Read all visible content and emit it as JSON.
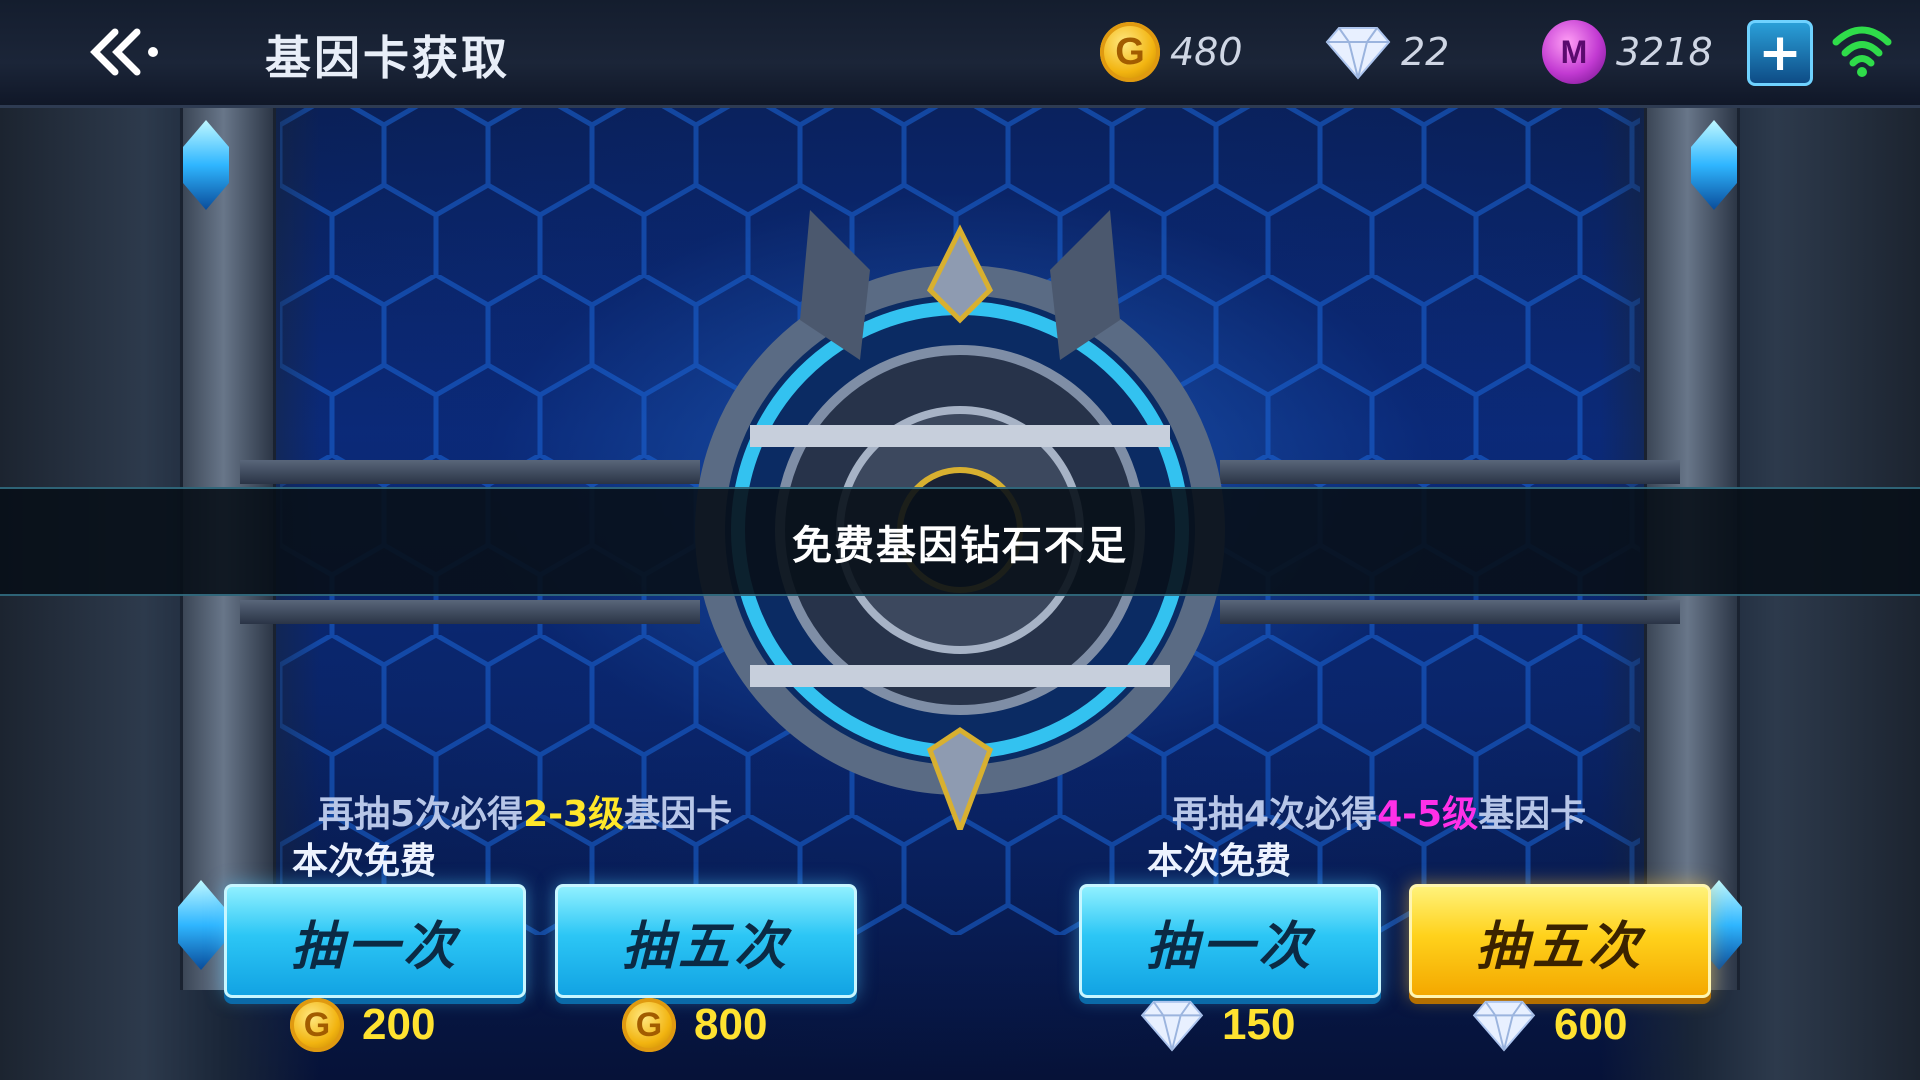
{
  "header": {
    "title": "基因卡获取",
    "back_icon": "double-chevron-left-icon",
    "currencies": {
      "gold": {
        "icon": "gold-coin-icon",
        "glyph": "G",
        "value": "480"
      },
      "diamond": {
        "icon": "diamond-icon",
        "value": "22"
      },
      "crystal": {
        "icon": "purple-crystal-icon",
        "glyph": "M",
        "value": "3218"
      }
    },
    "add_icon": "plus-icon",
    "wifi_icon": "wifi-icon"
  },
  "toast": {
    "message": "免费基因钻石不足"
  },
  "pools": [
    {
      "hint_prefix": "再抽5次必得",
      "hint_highlight": "2-3级",
      "hint_suffix": "基因卡",
      "free_text": "本次免费",
      "buttons": [
        {
          "label": "抽一次",
          "currency": "gold",
          "price": "200"
        },
        {
          "label": "抽五次",
          "currency": "gold",
          "price": "800"
        }
      ]
    },
    {
      "hint_prefix": "再抽4次必得",
      "hint_highlight": "4-5级",
      "hint_suffix": "基因卡",
      "free_text": "本次免费",
      "buttons": [
        {
          "label": "抽一次",
          "currency": "diamond",
          "price": "150"
        },
        {
          "label": "抽五次",
          "currency": "diamond",
          "price": "600"
        }
      ]
    }
  ],
  "colors": {
    "highlight_yellow": "#ffe72a",
    "highlight_pink": "#ff30e8",
    "button_blue": "#2cc6f5",
    "button_gold": "#ffd21c",
    "price_yellow": "#ffe230"
  }
}
